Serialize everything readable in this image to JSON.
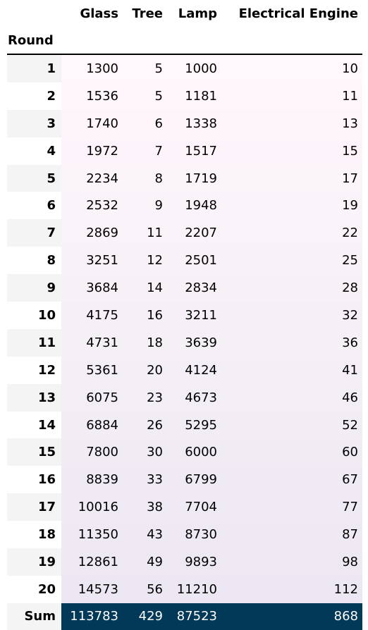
{
  "table": {
    "index_label": "Round",
    "columns": [
      "Glass",
      "Tree",
      "Lamp",
      "Electrical Engine"
    ],
    "rows": [
      {
        "round": "1",
        "values": [
          "1300",
          "5",
          "1000",
          "10"
        ]
      },
      {
        "round": "2",
        "values": [
          "1536",
          "5",
          "1181",
          "11"
        ]
      },
      {
        "round": "3",
        "values": [
          "1740",
          "6",
          "1338",
          "13"
        ]
      },
      {
        "round": "4",
        "values": [
          "1972",
          "7",
          "1517",
          "15"
        ]
      },
      {
        "round": "5",
        "values": [
          "2234",
          "8",
          "1719",
          "17"
        ]
      },
      {
        "round": "6",
        "values": [
          "2532",
          "9",
          "1948",
          "19"
        ]
      },
      {
        "round": "7",
        "values": [
          "2869",
          "11",
          "2207",
          "22"
        ]
      },
      {
        "round": "8",
        "values": [
          "3251",
          "12",
          "2501",
          "25"
        ]
      },
      {
        "round": "9",
        "values": [
          "3684",
          "14",
          "2834",
          "28"
        ]
      },
      {
        "round": "10",
        "values": [
          "4175",
          "16",
          "3211",
          "32"
        ]
      },
      {
        "round": "11",
        "values": [
          "4731",
          "18",
          "3639",
          "36"
        ]
      },
      {
        "round": "12",
        "values": [
          "5361",
          "20",
          "4124",
          "41"
        ]
      },
      {
        "round": "13",
        "values": [
          "6075",
          "23",
          "4673",
          "46"
        ]
      },
      {
        "round": "14",
        "values": [
          "6884",
          "26",
          "5295",
          "52"
        ]
      },
      {
        "round": "15",
        "values": [
          "7800",
          "30",
          "6000",
          "60"
        ]
      },
      {
        "round": "16",
        "values": [
          "8839",
          "33",
          "6799",
          "67"
        ]
      },
      {
        "round": "17",
        "values": [
          "10016",
          "38",
          "7704",
          "77"
        ]
      },
      {
        "round": "18",
        "values": [
          "11350",
          "43",
          "8730",
          "87"
        ]
      },
      {
        "round": "19",
        "values": [
          "12861",
          "49",
          "9893",
          "98"
        ]
      },
      {
        "round": "20",
        "values": [
          "14573",
          "56",
          "11210",
          "112"
        ]
      }
    ],
    "sum_row": {
      "label": "Sum",
      "values": [
        "113783",
        "429",
        "87523",
        "868"
      ]
    }
  },
  "colors": {
    "gradient_top": "#fff7fb",
    "gradient_bottom": "#ece7f2",
    "sum_background": "#023858",
    "sum_text": "#ffffff",
    "index_stripe": "#f4f4f4"
  }
}
